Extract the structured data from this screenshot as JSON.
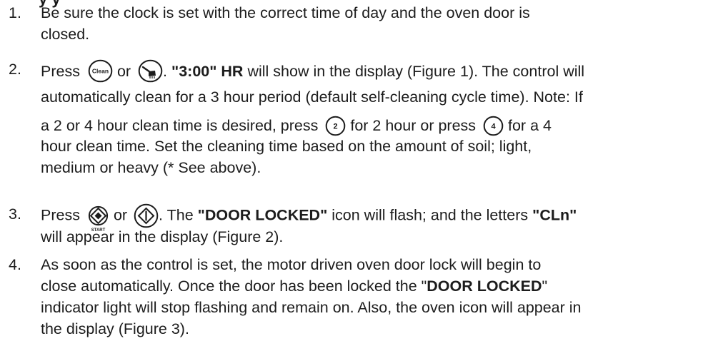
{
  "heading_partial": "y                    y",
  "steps": [
    {
      "number": "1.",
      "lines": [
        "Be sure the clock is set with the correct time of day and the oven door is",
        "closed."
      ]
    },
    {
      "number": "2.",
      "line1": {
        "pre": "Press",
        "or": "or",
        "dot": ".",
        "bold": "\"3:00\" HR",
        "post": "will show in the display (Figure 1). The control will"
      },
      "line2": "automatically clean for a 3 hour period (default self-cleaning cycle time). Note: If",
      "line3": {
        "pre": "a 2 or 4 hour clean time is desired, press",
        "mid": "for 2 hour or press",
        "post": "for a 4"
      },
      "line4": "hour clean time. Set the cleaning time based on the amount of soil; light,",
      "line5": "medium or heavy (* See above)."
    },
    {
      "number": "3.",
      "line1": {
        "pre": "Press",
        "or": "or",
        "mid": ". The",
        "bold1": "\"DOOR LOCKED\"",
        "mid2": "icon will flash; and the letters",
        "bold2": "\"CLn\""
      },
      "line2": "will appear in the display (Figure 2)."
    },
    {
      "number": "4.",
      "line1": "As soon as the control is set, the motor driven oven door lock will begin to",
      "line2": {
        "pre": "close automatically. Once the door has been locked the \"",
        "bold": "DOOR LOCKED",
        "post": "\""
      },
      "line3": "indicator light will stop flashing and remain on. Also, the oven icon will appear in",
      "line4": "the display (Figure 3)."
    }
  ],
  "buttons": {
    "clean_label": "Clean",
    "two_label": "2",
    "four_label": "4",
    "start_label": "START"
  },
  "icons": [
    "clean-button-icon",
    "brush-button-icon",
    "two-button-icon",
    "four-button-icon",
    "start-button-icon",
    "start-outline-button-icon"
  ]
}
